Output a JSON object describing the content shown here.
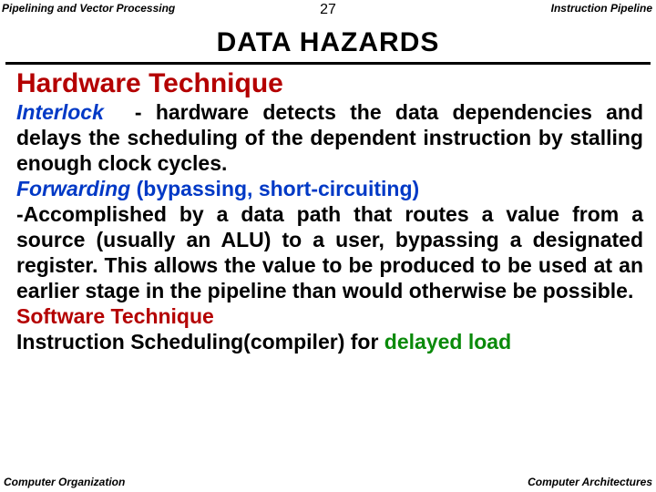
{
  "header": {
    "left": "Pipelining and Vector Processing",
    "center": "27",
    "right": "Instruction Pipeline"
  },
  "title": "DATA  HAZARDS",
  "section1": "Hardware Technique",
  "p1": {
    "kw": "Interlock",
    "dash": "-",
    "rest1": "hardware detects the data",
    "rest2": "dependencies and delays the scheduling of the dependent instruction by stalling enough clock cycles."
  },
  "p2": {
    "kw": "Forwarding",
    "paren": " (bypassing, short-circuiting)",
    "body": "-Accomplished by a data path that routes a value from a source (usually an ALU) to a user, bypassing a designated register. This allows the value to be produced to be used at an earlier stage in the  pipeline than would otherwise be possible."
  },
  "section2": "Software Technique",
  "p3": {
    "lead": " Instruction Scheduling(compiler) for ",
    "kw": "delayed load"
  },
  "footer": {
    "left": "Computer Organization",
    "right": "Computer Architectures"
  }
}
